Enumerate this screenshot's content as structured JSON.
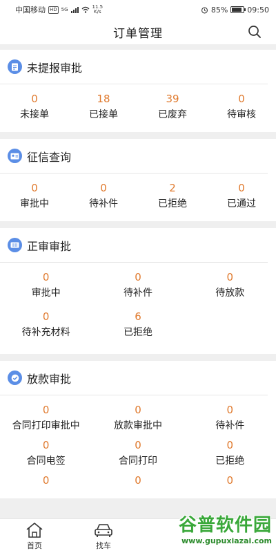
{
  "status_bar": {
    "carrier": "中国移动",
    "hd_badge": "HD",
    "network": "5G",
    "speed_value": "11.5",
    "speed_unit": "K/s",
    "battery": "85%",
    "time": "09:50"
  },
  "header": {
    "title": "订单管理",
    "search_icon": "search-icon"
  },
  "sections": [
    {
      "title": "未提报审批",
      "icon": "document-icon",
      "items": [
        {
          "value": "0",
          "label": "未接单"
        },
        {
          "value": "18",
          "label": "已接单"
        },
        {
          "value": "39",
          "label": "已废弃"
        },
        {
          "value": "0",
          "label": "待审核"
        }
      ]
    },
    {
      "title": "征信查询",
      "icon": "id-card-icon",
      "items": [
        {
          "value": "0",
          "label": "审批中"
        },
        {
          "value": "0",
          "label": "待补件"
        },
        {
          "value": "2",
          "label": "已拒绝"
        },
        {
          "value": "0",
          "label": "已通过"
        }
      ]
    },
    {
      "title": "正审审批",
      "icon": "ticket-icon",
      "items": [
        {
          "value": "0",
          "label": "审批中"
        },
        {
          "value": "0",
          "label": "待补件"
        },
        {
          "value": "0",
          "label": "待放款"
        },
        {
          "value": "0",
          "label": "待补充材料"
        },
        {
          "value": "6",
          "label": "已拒绝"
        }
      ]
    },
    {
      "title": "放款审批",
      "icon": "verified-badge-icon",
      "items": [
        {
          "value": "0",
          "label": "合同打印审批中"
        },
        {
          "value": "0",
          "label": "放款审批中"
        },
        {
          "value": "0",
          "label": "待补件"
        },
        {
          "value": "0",
          "label": "合同电签"
        },
        {
          "value": "0",
          "label": "合同打印"
        },
        {
          "value": "0",
          "label": "已拒绝"
        },
        {
          "value": "0",
          "label": ""
        },
        {
          "value": "0",
          "label": ""
        },
        {
          "value": "0",
          "label": ""
        }
      ]
    }
  ],
  "tabbar": [
    {
      "label": "首页",
      "icon": "home-icon"
    },
    {
      "label": "找车",
      "icon": "car-icon"
    }
  ],
  "watermark": {
    "main": "谷普软件园",
    "url": "www.gupuxiazai.com"
  },
  "colors": {
    "accent": "#5b8ee6",
    "number": "#e07a2e",
    "watermark": "#3aa83a"
  }
}
